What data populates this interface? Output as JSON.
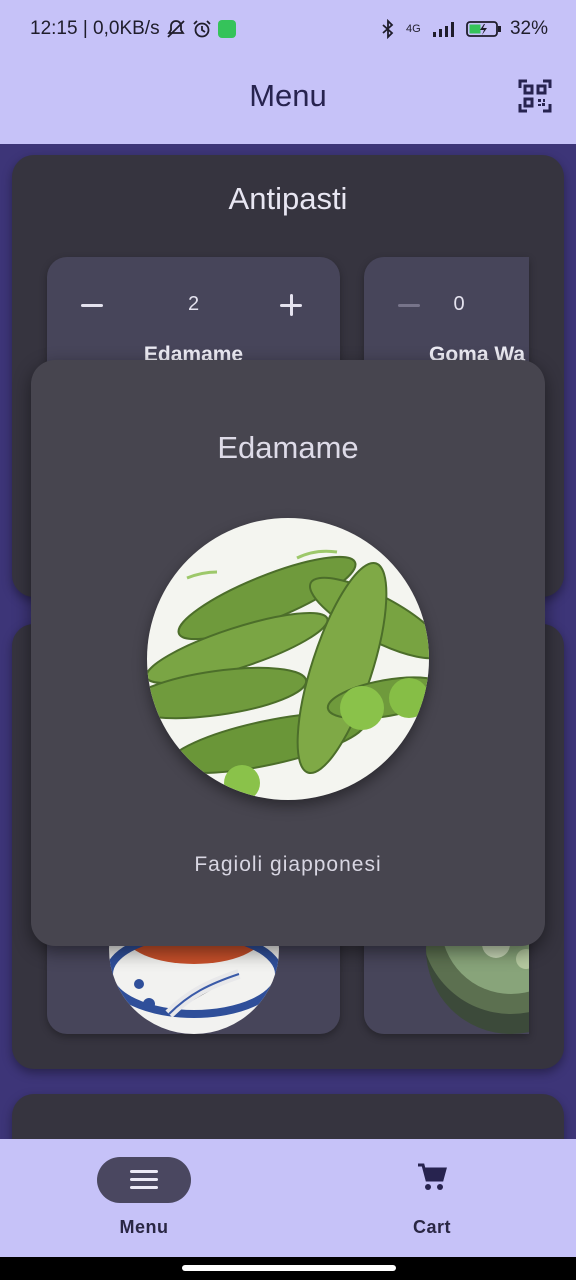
{
  "status_bar": {
    "time": "12:15 | 0,0KB/s",
    "network": "4G",
    "battery": "32%",
    "icons": [
      "mute-icon",
      "alarm-icon",
      "whatsapp-icon",
      "bluetooth-icon",
      "signal-icon",
      "battery-icon"
    ]
  },
  "app_bar": {
    "title": "Menu",
    "qr_icon": "qr-code-icon"
  },
  "sections": [
    {
      "title": "Antipasti",
      "items": [
        {
          "name": "Edamame",
          "quantity": "2"
        },
        {
          "name": "Goma Wa",
          "quantity": "0"
        }
      ]
    }
  ],
  "dialog": {
    "title": "Edamame",
    "description": "Fagioli giapponesi"
  },
  "bottom_nav": {
    "items": [
      {
        "label": "Menu",
        "icon": "menu-icon",
        "selected": true
      },
      {
        "label": "Cart",
        "icon": "cart-icon",
        "selected": false
      }
    ]
  },
  "colors": {
    "primary_container": "#c6c2f8",
    "background": "#3d3578",
    "surface": "#36343f",
    "card": "#47455a",
    "dialog": "#47454f",
    "nav_pill": "#4a4760"
  }
}
